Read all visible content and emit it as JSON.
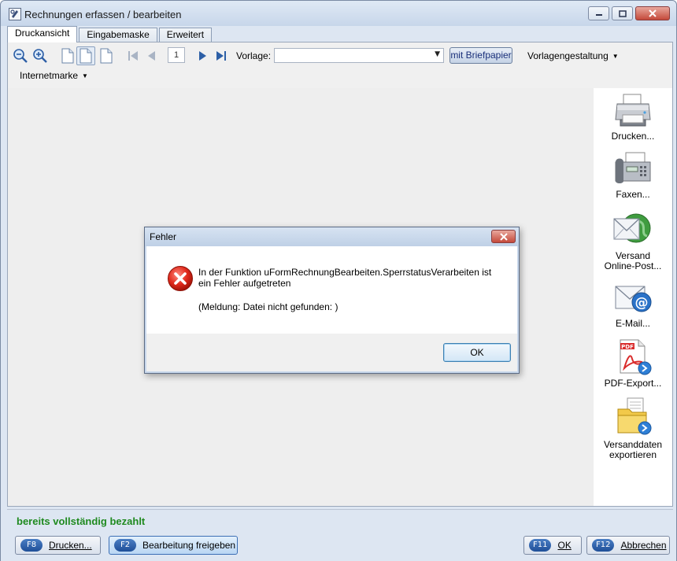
{
  "window": {
    "title": "Rechnungen erfassen / bearbeiten"
  },
  "tabs": [
    {
      "label": "Druckansicht",
      "active": true
    },
    {
      "label": "Eingabemaske",
      "active": false
    },
    {
      "label": "Erweitert",
      "active": false
    }
  ],
  "toolbar": {
    "page_number": "1",
    "vorlage_label": "Vorlage:",
    "vorlage_value": "",
    "briefpapier_label": "mit Briefpapier",
    "vorlagengestaltung_label": "Vorlagengestaltung",
    "internetmarke_label": "Internetmarke"
  },
  "side_actions": [
    {
      "line1": "Drucken...",
      "line2": ""
    },
    {
      "line1": "Faxen...",
      "line2": ""
    },
    {
      "line1": "Versand",
      "line2": "Online-Post..."
    },
    {
      "line1": "E-Mail...",
      "line2": ""
    },
    {
      "line1": "PDF-Export...",
      "line2": ""
    },
    {
      "line1": "Versanddaten",
      "line2": "exportieren"
    }
  ],
  "status": {
    "text": "bereits vollständig bezahlt",
    "color": "#1f8a1f"
  },
  "bottom_buttons": {
    "print": {
      "key": "F8",
      "label": "Drucken..."
    },
    "release": {
      "key": "F2",
      "label": "Bearbeitung freigeben"
    },
    "ok": {
      "key": "F11",
      "label": "OK"
    },
    "cancel": {
      "key": "F12",
      "label": "Abbrechen"
    }
  },
  "dialog": {
    "title": "Fehler",
    "message_line1": "In der Funktion uFormRechnungBearbeiten.SperrstatusVerarbeiten ist",
    "message_line2": "ein Fehler aufgetreten",
    "detail": "(Meldung: Datei nicht gefunden: )",
    "ok_label": "OK"
  }
}
